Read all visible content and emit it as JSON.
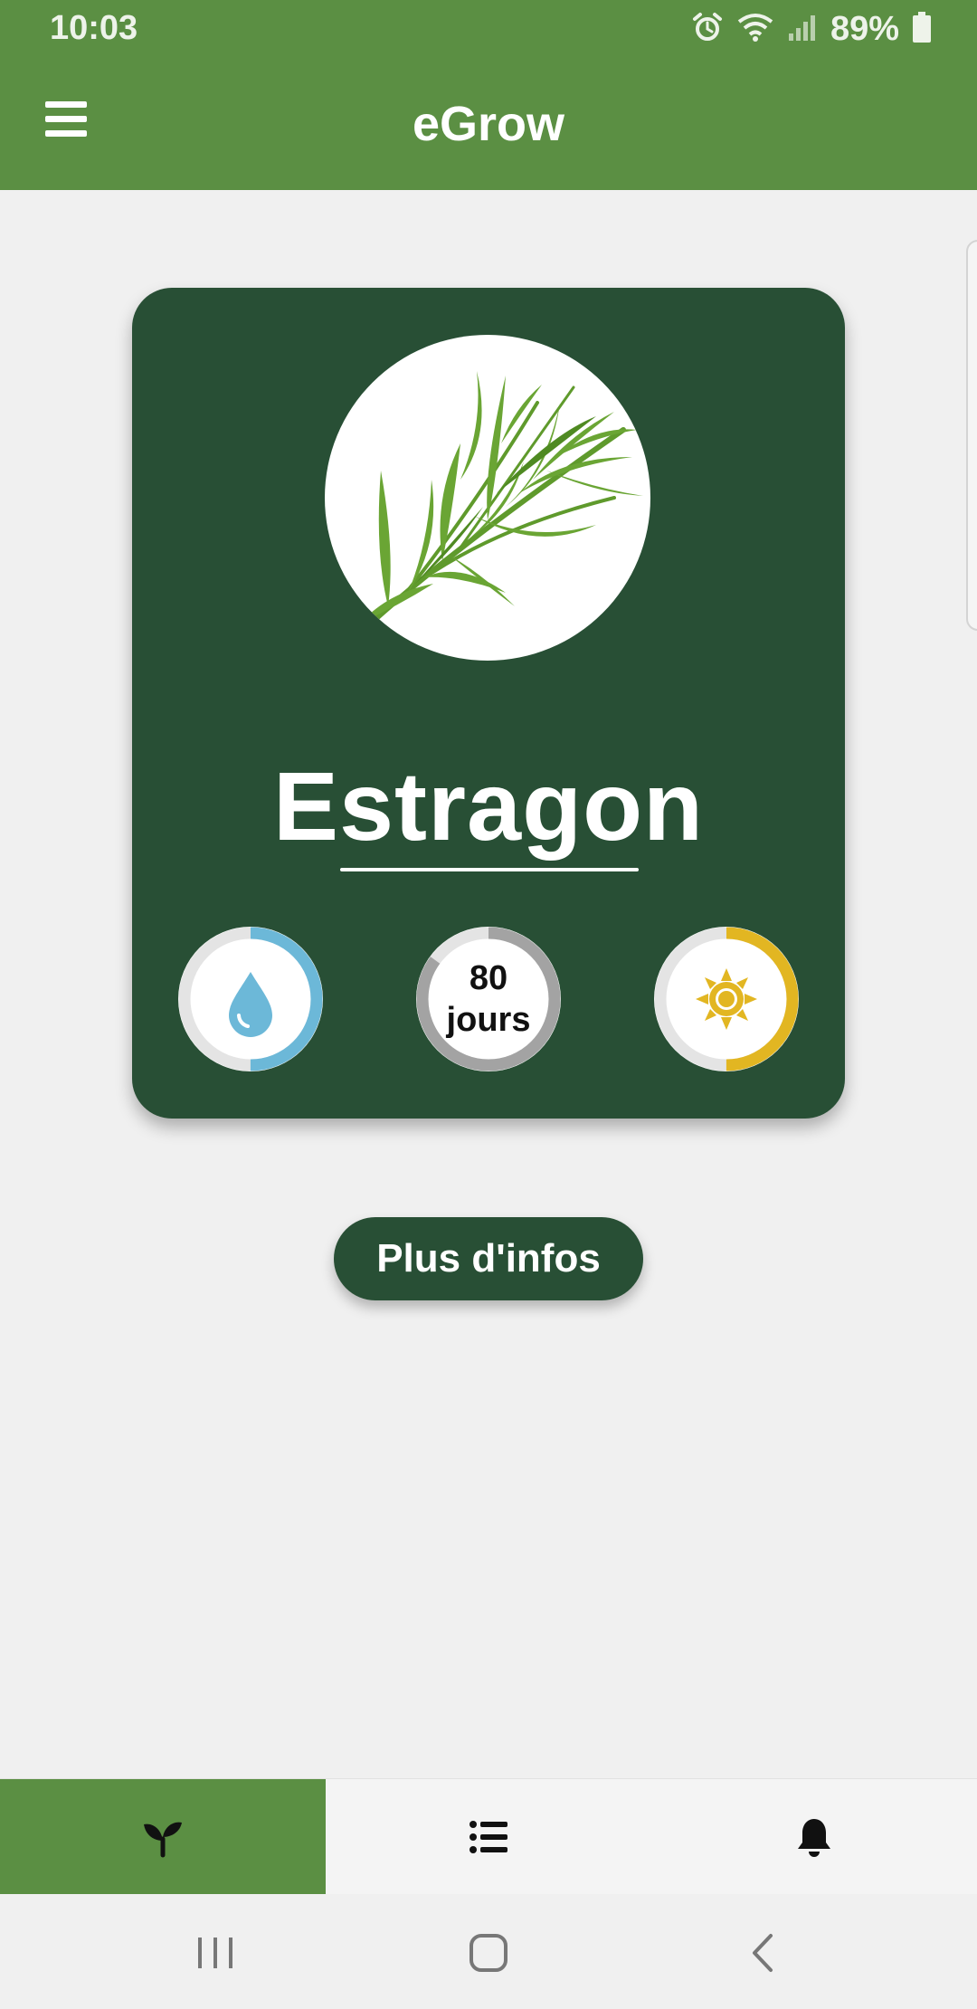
{
  "status_bar": {
    "time": "10:03",
    "battery": "89%",
    "icons": [
      "alarm-icon",
      "wifi-icon",
      "signal-icon",
      "battery-icon"
    ]
  },
  "app_bar": {
    "title": "eGrow",
    "menu_icon": "hamburger-menu-icon"
  },
  "plant": {
    "name": "Estragon",
    "image": "tarragon-sprig-photo",
    "gauges": {
      "water": {
        "icon": "water-drop-icon",
        "level": 0.5,
        "color": "#6cb8d8"
      },
      "days": {
        "value": "80",
        "unit": "jours",
        "level": 0.85,
        "color": "#a3a3a3"
      },
      "sun": {
        "icon": "sun-icon",
        "level": 0.5,
        "color": "#e2b622"
      }
    }
  },
  "more_info_button": {
    "label": "Plus d'infos"
  },
  "bottom_nav": {
    "items": [
      {
        "icon": "sprout-icon",
        "active": true
      },
      {
        "icon": "list-icon",
        "active": false
      },
      {
        "icon": "bell-icon",
        "active": false
      }
    ]
  },
  "colors": {
    "primary": "#5b8f43",
    "card": "#284f35",
    "background": "#f0f0f0"
  }
}
